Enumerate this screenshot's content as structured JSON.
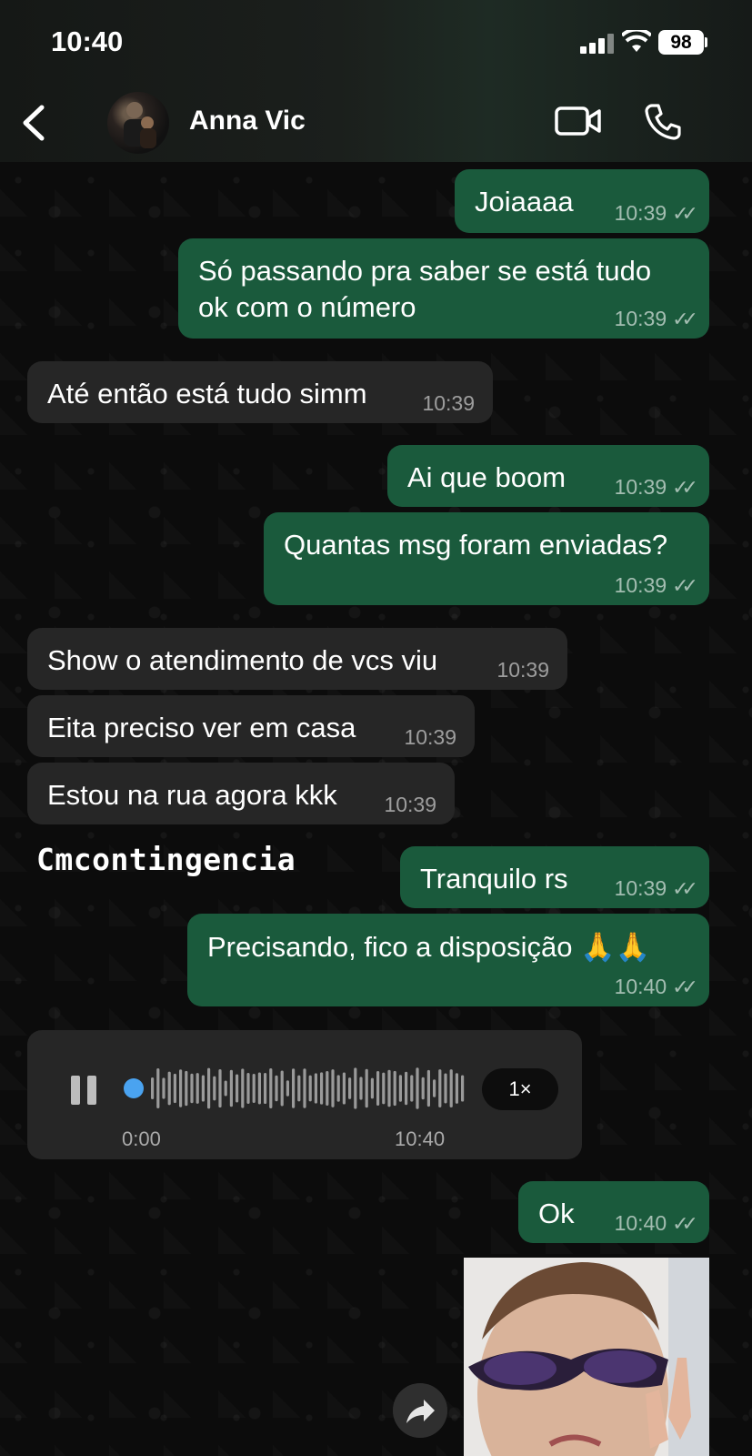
{
  "status_bar": {
    "time": "10:40",
    "battery": "98"
  },
  "header": {
    "contact_name": "Anna Vic"
  },
  "messages": [
    {
      "dir": "out",
      "text": "Joiaaaa",
      "time": "10:39"
    },
    {
      "dir": "out",
      "text": "Só passando pra saber se está tudo",
      "text2": "ok com o número",
      "time": "10:39"
    },
    {
      "dir": "in",
      "text": "Até então está tudo simm",
      "time": "10:39"
    },
    {
      "dir": "out",
      "text": "Ai que boom",
      "time": "10:39"
    },
    {
      "dir": "out",
      "text": "Quantas msg foram enviadas?",
      "time": "10:39"
    },
    {
      "dir": "in",
      "text": "Show o atendimento de vcs viu",
      "time": "10:39"
    },
    {
      "dir": "in",
      "text": "Eita preciso ver em casa",
      "time": "10:39"
    },
    {
      "dir": "in",
      "text": "Estou na rua agora kkk",
      "time": "10:39"
    },
    {
      "dir": "out",
      "text": "Tranquilo rs",
      "time": "10:39"
    },
    {
      "dir": "out",
      "text": "Precisando, fico a disposição 🙏🙏",
      "time": "10:40"
    },
    {
      "dir": "out",
      "text": "Ok",
      "time": "10:40"
    }
  ],
  "voice_note": {
    "position": "0:00",
    "time": "10:40",
    "speed": "1×",
    "progress": 0
  },
  "watermark": "Cmcontingencia",
  "icons": [
    "back-arrow-icon",
    "video-call-icon",
    "phone-call-icon",
    "pause-icon",
    "forward-icon",
    "double-check-icon"
  ]
}
